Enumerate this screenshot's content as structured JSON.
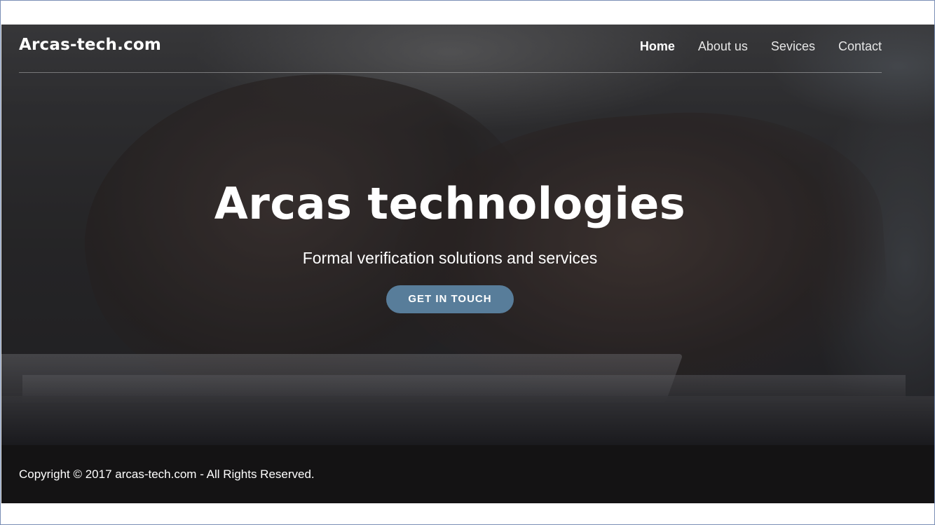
{
  "header": {
    "brand": "Arcas-tech.com",
    "nav": [
      {
        "label": "Home",
        "active": true
      },
      {
        "label": "About us",
        "active": false
      },
      {
        "label": "Sevices",
        "active": false
      },
      {
        "label": "Contact",
        "active": false
      }
    ]
  },
  "hero": {
    "title": "Arcas technologies",
    "subtitle": "Formal verification solutions and services",
    "cta_label": "GET IN TOUCH",
    "background": "laptop-typing-photo"
  },
  "footer": {
    "copyright": "Copyright © 2017 arcas-tech.com - All Rights Reserved."
  },
  "colors": {
    "accent": "#587d9a",
    "footer_bg": "#141314",
    "text": "#ffffff"
  }
}
